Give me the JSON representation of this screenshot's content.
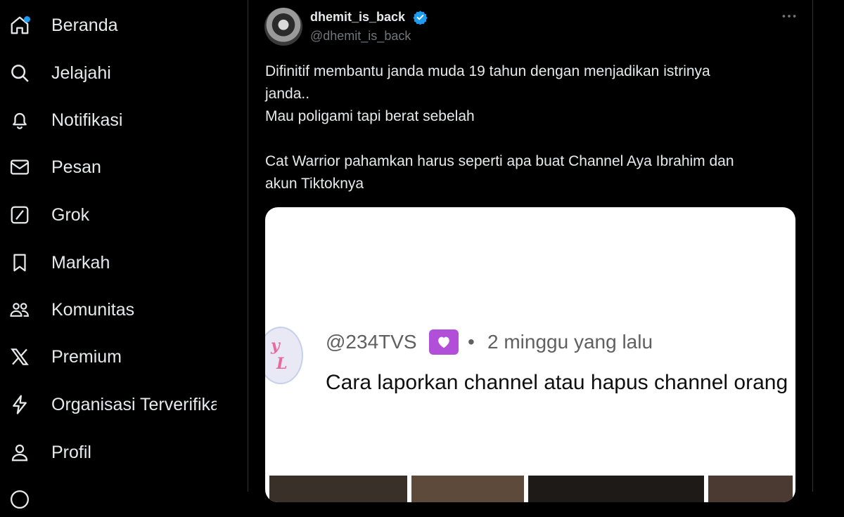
{
  "sidebar": {
    "items": [
      {
        "label": "Beranda",
        "icon": "home-icon"
      },
      {
        "label": "Jelajahi",
        "icon": "search-icon"
      },
      {
        "label": "Notifikasi",
        "icon": "bell-icon"
      },
      {
        "label": "Pesan",
        "icon": "envelope-icon"
      },
      {
        "label": "Grok",
        "icon": "grok-icon"
      },
      {
        "label": "Markah",
        "icon": "bookmark-icon"
      },
      {
        "label": "Komunitas",
        "icon": "people-icon"
      },
      {
        "label": "Premium",
        "icon": "x-logo-icon"
      },
      {
        "label": "Organisasi Terverifikasi",
        "icon": "lightning-icon"
      },
      {
        "label": "Profil",
        "icon": "user-icon"
      }
    ]
  },
  "tweet": {
    "display_name": "dhemit_is_back",
    "handle": "@dhemit_is_back",
    "text_lines": [
      "Difinitif membantu janda muda 19 tahun dengan menjadikan istrinya",
      "janda..",
      "Mau poligami tapi berat sebelah",
      "",
      "Cat Warrior pahamkan harus seperti apa buat Channel Aya Ibrahim dan",
      "akun Tiktoknya"
    ],
    "media": {
      "commenter": "@234TVS",
      "separator": "•",
      "time_ago": "2 minggu yang lalu",
      "comment": "Cara laporkan channel atau hapus channel orang"
    }
  },
  "colors": {
    "background": "#000000",
    "text": "#e7e9ea",
    "muted": "#71767b",
    "accent": "#1d9bf0",
    "divider": "#2f3336",
    "badge": "#b24fd8"
  }
}
